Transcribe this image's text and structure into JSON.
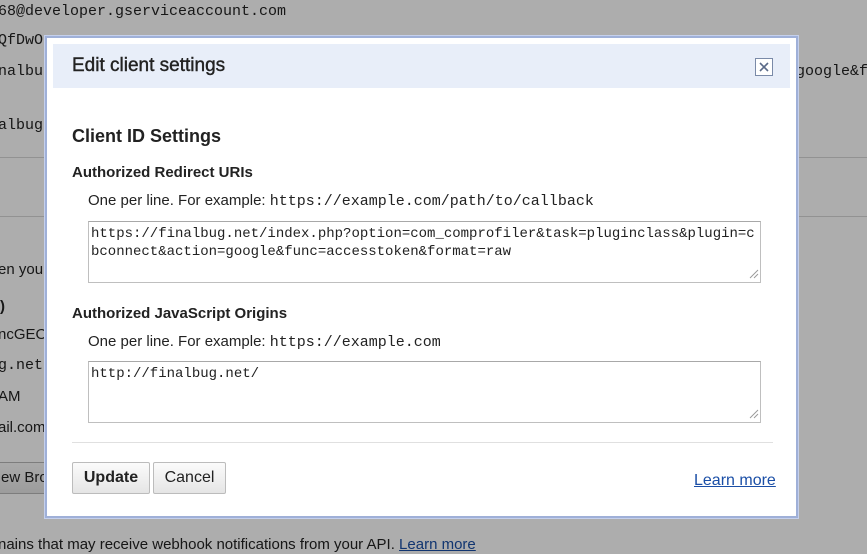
{
  "background": {
    "lines": [
      {
        "id": "service-account",
        "text": "68@developer.gserviceaccount.com"
      },
      {
        "id": "client-secret-fragment",
        "text": "QfDwO"
      },
      {
        "id": "redirect-fragment-left",
        "text": "nalbu"
      },
      {
        "id": "redirect-fragment-right",
        "text": "google&f"
      },
      {
        "id": "origin-fragment",
        "text": "albug"
      },
      {
        "id": "when-you-fragment",
        "text": "en you"
      },
      {
        "id": "paren-fragment",
        "text": ")"
      },
      {
        "id": "key-fragment",
        "text": "ncGEO"
      },
      {
        "id": "domain-fragment",
        "text": "g.net"
      },
      {
        "id": "time-fragment",
        "text": "AM"
      },
      {
        "id": "email-fragment",
        "text": "ail.com"
      }
    ],
    "new_browser_button": "ew Bro",
    "footer_text": "nains that may receive webhook notifications from your API.",
    "footer_link": "Learn more"
  },
  "dialog": {
    "title": "Edit client settings",
    "close_icon": "close-icon",
    "section_title": "Client ID Settings",
    "redirect": {
      "label": "Authorized Redirect URIs",
      "hint_prefix": "One per line. For example: ",
      "hint_example": "https://example.com/path/to/callback",
      "value": "https://finalbug.net/index.php?option=com_comprofiler&task=pluginclass&plugin=cbconnect&action=google&func=accesstoken&format=raw"
    },
    "origins": {
      "label": "Authorized JavaScript Origins",
      "hint_prefix": "One per line. For example: ",
      "hint_example": "https://example.com",
      "value": "http://finalbug.net/"
    },
    "buttons": {
      "update": "Update",
      "cancel": "Cancel"
    },
    "learn_more": "Learn more"
  },
  "colors": {
    "header_bg": "#e8eef9",
    "frame_border": "#9fb0d8",
    "link": "#1a4ea6",
    "overlay": "rgba(0,0,0,0.32)"
  }
}
